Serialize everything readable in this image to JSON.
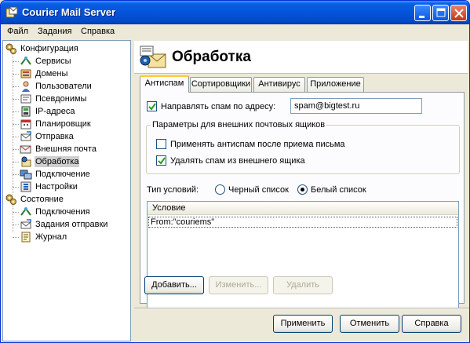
{
  "window": {
    "title": "Courier Mail Server"
  },
  "menu": [
    "Файл",
    "Задания",
    "Справка"
  ],
  "tree": {
    "config": {
      "label": "Конфигурация",
      "items": [
        "Сервисы",
        "Домены",
        "Пользователи",
        "Псевдонимы",
        "IP-адреса",
        "Планировщик",
        "Отправка",
        "Внешняя почта",
        "Обработка",
        "Подключение",
        "Настройки"
      ]
    },
    "state": {
      "label": "Состояние",
      "items": [
        "Подключения",
        "Задания отправки",
        "Журнал"
      ]
    },
    "selected": "Обработка"
  },
  "page": {
    "title": "Обработка"
  },
  "tabs": [
    "Антиспам",
    "Сортировщики",
    "Антивирус",
    "Приложение"
  ],
  "active_tab": "Антиспам",
  "antispam": {
    "forward_label": "Направлять спам по адресу:",
    "forward_checked": true,
    "forward_address": "spam@bigtest.ru",
    "group_label": "Параметры для внешних почтовых ящиков",
    "apply_after_label": "Применять антиспам после приема письма",
    "apply_after_checked": false,
    "delete_label": "Удалять спам из внешнего ящика",
    "delete_checked": true,
    "condition_type_label": "Тип условий:",
    "radio_black": "Черный список",
    "radio_white": "Белый список",
    "selected_list": "Белый список",
    "list_header": "Условие",
    "conditions": [
      "From:\"couriems\""
    ]
  },
  "list_buttons": {
    "add": "Добавить...",
    "edit": "Изменить...",
    "delete": "Удалить"
  },
  "dialog_buttons": {
    "apply": "Применить",
    "cancel": "Отменить",
    "help": "Справка"
  },
  "colors": {
    "titlebar": "#0454d9",
    "window_bg": "#ece9d8",
    "tab_highlight": "#ffc83c"
  }
}
